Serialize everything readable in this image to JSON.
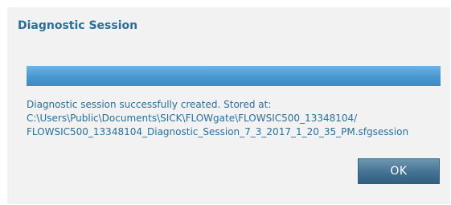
{
  "dialog": {
    "title": "Diagnostic Session",
    "progress": 1.0,
    "message_lines": [
      "Diagnostic session successfully created. Stored at:",
      "C:\\Users\\Public\\Documents\\SICK\\FLOWgate\\FLOWSIC500_13348104/",
      "FLOWSIC500_13348104_Diagnostic_Session_7_3_2017_1_20_35_PM.sfgsession"
    ],
    "ok_label": "OK"
  }
}
